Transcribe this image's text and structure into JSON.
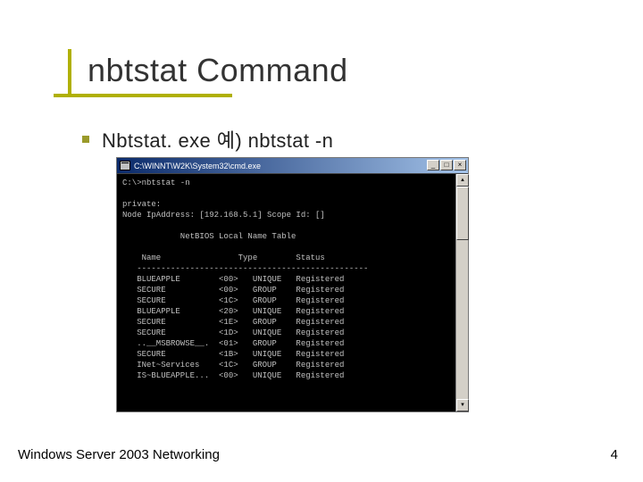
{
  "title": "nbtstat Command",
  "bullet": "Nbtstat. exe  예) nbtstat -n",
  "console": {
    "window_title": "C:\\WINNT\\W2K\\System32\\cmd.exe",
    "prompt": "C:\\>nbtstat -n",
    "interface": "private:",
    "node_line": "Node IpAddress: [192.168.5.1] Scope Id: []",
    "table_title": "NetBIOS Local Name Table",
    "columns": {
      "c1": "Name",
      "c2": "Type",
      "c3": "Status"
    },
    "divider": "------------------------------------------------",
    "rows": [
      {
        "name": "BLUEAPPLE",
        "code": "<00>",
        "type": "UNIQUE",
        "status": "Registered"
      },
      {
        "name": "SECURE",
        "code": "<00>",
        "type": "GROUP",
        "status": "Registered"
      },
      {
        "name": "SECURE",
        "code": "<1C>",
        "type": "GROUP",
        "status": "Registered"
      },
      {
        "name": "BLUEAPPLE",
        "code": "<20>",
        "type": "UNIQUE",
        "status": "Registered"
      },
      {
        "name": "SECURE",
        "code": "<1E>",
        "type": "GROUP",
        "status": "Registered"
      },
      {
        "name": "SECURE",
        "code": "<1D>",
        "type": "UNIQUE",
        "status": "Registered"
      },
      {
        "name": "..__MSBROWSE__.",
        "code": "<01>",
        "type": "GROUP",
        "status": "Registered"
      },
      {
        "name": "SECURE",
        "code": "<1B>",
        "type": "UNIQUE",
        "status": "Registered"
      },
      {
        "name": "INet~Services",
        "code": "<1C>",
        "type": "GROUP",
        "status": "Registered"
      },
      {
        "name": "IS~BLUEAPPLE...",
        "code": "<00>",
        "type": "UNIQUE",
        "status": "Registered"
      }
    ]
  },
  "footer": {
    "left": "Windows  Server 2003 Networking",
    "page": "4"
  }
}
